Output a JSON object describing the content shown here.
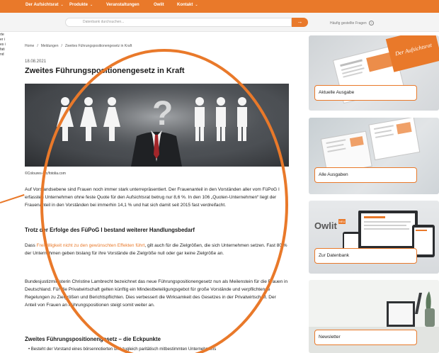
{
  "topnav": {
    "items": [
      {
        "label": "Der Aufsichtsrat",
        "has_caret": true
      },
      {
        "label": "Produkte",
        "has_caret": true
      },
      {
        "label": "Veranstaltungen",
        "has_caret": false
      },
      {
        "label": "Owlit",
        "has_caret": false
      },
      {
        "label": "Kontakt",
        "has_caret": true
      }
    ],
    "caret": "⌄"
  },
  "search": {
    "placeholder": "Datenbank durchsuchen...",
    "button_icon": "→",
    "faq_label": "Häufig gestellte Fragen",
    "faq_icon": "?"
  },
  "left_fragments": [
    "rte",
    "er i",
    "es i",
    "fati",
    "nd"
  ],
  "breadcrumb": {
    "items": [
      "Home",
      "Meldungen",
      "Zweites Führungspositionengesetz in Kraft"
    ],
    "separator": "/"
  },
  "article": {
    "date": "18.08.2021",
    "title": "Zweites Führungspositionengesetz in Kraft",
    "image_credit": "©Coloures-Pic/fotolia.com",
    "hero_question_mark": "?",
    "intro": "Auf Vorstandsebene sind Frauen noch immer stark unterrepräsentiert. Der Frauenanteil in den Vorständen aller vom FüPoG I erfassten Unternehmen ohne feste Quote für den Aufsichtsrat betrug nur 8,6 %. In den 106 „Quoten-Unternehmen“ liegt der Frauenanteil in den Vorständen bei immerhin 14,1 % und hat sich damit seit 2015 fast verdreifacht.",
    "heading1": "Trotz der Erfolge des FüPoG I bestand weiterer Handlungsbedarf",
    "para2_before": "Dass ",
    "para2_link": "Freiwilligkeit nicht zu den gewünschten Effekten führt",
    "para2_after": ", gilt auch für die Zielgrößen, die sich Unternehmen setzen. Fast 80 % der Unternehmen geben bislang für ihre Vorstände die Zielgröße null oder gar keine Zielgröße an.",
    "para3": "Bundesjustizministerin Christine Lambrecht bezeichnet das neue Führungspositionengesetz nun als Meilenstein für die Frauen in Deutschland. Für die Privatwirtschaft gelten künftig ein Mindestbeteiligungsgebot für große Vorstände und verpflichtende Regelungen zu Zielgrößen und Berichtspflichten. Dies verbessert die Wirksamkeit des Gesetzes in der Privatwirtschaft. Der Anteil von Frauen an Führungspositionen steigt somit weiter an.",
    "heading2": "Zweites Führungspositionengesetz – die Eckpunkte",
    "bullet1": "Besteht der Vorstand eines börsennotierten und zugleich paritätisch mitbestimmten Unternehmens"
  },
  "sidebar": {
    "cards": [
      {
        "label": "Aktuelle Ausgabe",
        "magazine_text": "Der Aufsichtsrat"
      },
      {
        "label": "Alle Ausgaben"
      },
      {
        "label": "Zur Datenbank",
        "logo_text": "Owlit",
        "logo_badge": "NEU"
      },
      {
        "label": "Newsletter"
      }
    ]
  },
  "colors": {
    "accent": "#e9792a",
    "nav_bg": "#e9792a",
    "text": "#222222"
  }
}
